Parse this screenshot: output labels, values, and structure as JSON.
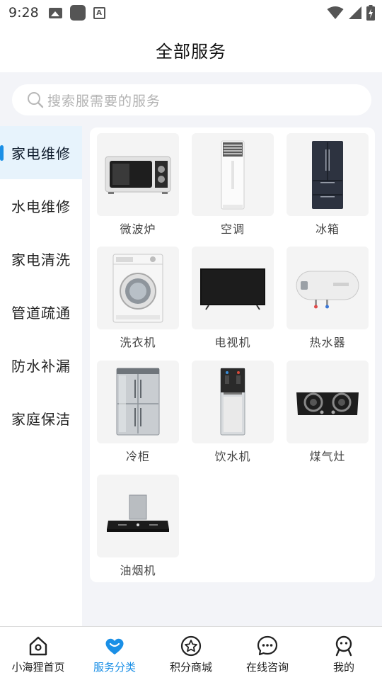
{
  "status_bar": {
    "time": "9:28",
    "left_icons": [
      "image-icon",
      "app-square-icon",
      "font-icon"
    ],
    "right_icons": [
      "wifi-icon",
      "signal-icon",
      "battery-charging-icon"
    ]
  },
  "header": {
    "title": "全部服务"
  },
  "search": {
    "placeholder": "搜索服需要的服务",
    "icon": "search-icon"
  },
  "sidebar": {
    "items": [
      {
        "label": "家电维修",
        "active": true
      },
      {
        "label": "水电维修",
        "active": false
      },
      {
        "label": "家电清洗",
        "active": false
      },
      {
        "label": "管道疏通",
        "active": false
      },
      {
        "label": "防水补漏",
        "active": false
      },
      {
        "label": "家庭保洁",
        "active": false
      }
    ]
  },
  "services": [
    {
      "label": "微波炉",
      "icon": "microwave-icon"
    },
    {
      "label": "空调",
      "icon": "air-conditioner-icon"
    },
    {
      "label": "冰箱",
      "icon": "refrigerator-icon"
    },
    {
      "label": "洗衣机",
      "icon": "washing-machine-icon"
    },
    {
      "label": "电视机",
      "icon": "tv-icon"
    },
    {
      "label": "热水器",
      "icon": "water-heater-icon"
    },
    {
      "label": "冷柜",
      "icon": "freezer-icon"
    },
    {
      "label": "饮水机",
      "icon": "water-dispenser-icon"
    },
    {
      "label": "煤气灶",
      "icon": "gas-stove-icon"
    },
    {
      "label": "油烟机",
      "icon": "range-hood-icon"
    }
  ],
  "bottom_nav": {
    "tabs": [
      {
        "label": "小海狸首页",
        "icon": "home-icon",
        "active": false
      },
      {
        "label": "服务分类",
        "icon": "heart-icon",
        "active": true
      },
      {
        "label": "积分商城",
        "icon": "star-icon",
        "active": false
      },
      {
        "label": "在线咨询",
        "icon": "chat-icon",
        "active": false
      },
      {
        "label": "我的",
        "icon": "profile-icon",
        "active": false
      }
    ]
  },
  "colors": {
    "accent": "#1a8fe6",
    "background": "#f3f4f8",
    "active_nav_bg": "#e7f3fc"
  }
}
